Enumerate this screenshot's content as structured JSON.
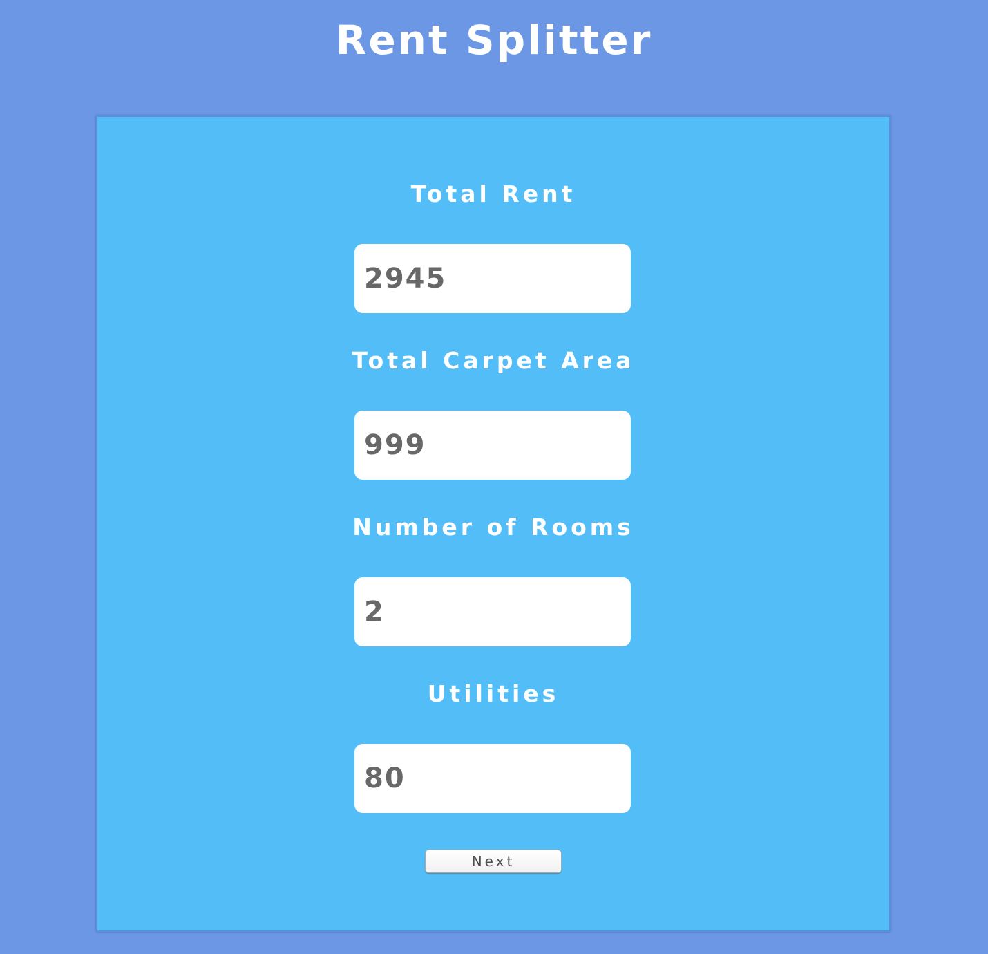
{
  "page": {
    "title": "Rent Splitter"
  },
  "form": {
    "fields": [
      {
        "label": "Total Rent",
        "value": "2945"
      },
      {
        "label": "Total Carpet Area",
        "value": "999"
      },
      {
        "label": "Number of Rooms",
        "value": "2"
      },
      {
        "label": "Utilities",
        "value": "80"
      }
    ],
    "next_label": "Next"
  },
  "colors": {
    "page_background": "#6c97e4",
    "panel_background": "#53bdf8",
    "label_text": "#ffffff",
    "input_text": "#686868"
  }
}
